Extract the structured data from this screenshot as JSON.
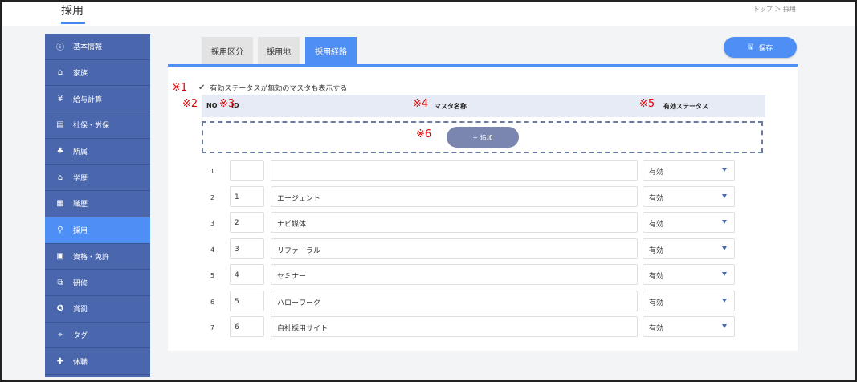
{
  "header": {
    "title": "採用",
    "breadcrumb": "トップ ＞ 採用"
  },
  "sidebar": {
    "items": [
      {
        "label": "基本情報",
        "icon": "info-icon",
        "glyph": "ⓘ",
        "active": false
      },
      {
        "label": "家族",
        "icon": "family-icon",
        "glyph": "⌂",
        "active": false
      },
      {
        "label": "給与計算",
        "icon": "salary-icon",
        "glyph": "¥",
        "active": false
      },
      {
        "label": "社保・労保",
        "icon": "insurance-icon",
        "glyph": "▤",
        "active": false
      },
      {
        "label": "所属",
        "icon": "org-chart-icon",
        "glyph": "♣",
        "active": false
      },
      {
        "label": "学歴",
        "icon": "graduation-cap-icon",
        "glyph": "⌂",
        "active": false
      },
      {
        "label": "職歴",
        "icon": "job-history-icon",
        "glyph": "▦",
        "active": false
      },
      {
        "label": "採用",
        "icon": "recruit-search-icon",
        "glyph": "⚲",
        "active": true
      },
      {
        "label": "資格・免許",
        "icon": "license-icon",
        "glyph": "▣",
        "active": false
      },
      {
        "label": "研修",
        "icon": "training-icon",
        "glyph": "⧉",
        "active": false
      },
      {
        "label": "賞罰",
        "icon": "award-icon",
        "glyph": "✪",
        "active": false
      },
      {
        "label": "タグ",
        "icon": "tag-icon",
        "glyph": "⌖",
        "active": false
      },
      {
        "label": "休職",
        "icon": "plus-cross-icon",
        "glyph": "✚",
        "active": false
      }
    ]
  },
  "tabs": [
    {
      "label": "採用区分",
      "active": false
    },
    {
      "label": "採用地",
      "active": false
    },
    {
      "label": "採用経路",
      "active": true
    }
  ],
  "toolbar": {
    "save_label": "保存",
    "save_icon": "save-icon"
  },
  "annotations": {
    "m1": "※1",
    "m2": "※2",
    "m3": "※3",
    "m4": "※4",
    "m5": "※5",
    "m6": "※6"
  },
  "filter": {
    "show_inactive_label": "有効ステータスが無効のマスタも表示する",
    "checked": true
  },
  "table": {
    "columns": {
      "no": "NO",
      "id": "ID",
      "name": "マスタ名称",
      "status": "有効ステータス"
    },
    "add_label": "+ 追加",
    "rows": [
      {
        "no": "1",
        "id": "",
        "name": "",
        "status": "有効"
      },
      {
        "no": "2",
        "id": "1",
        "name": "エージェント",
        "status": "有効"
      },
      {
        "no": "3",
        "id": "2",
        "name": "ナビ媒体",
        "status": "有効"
      },
      {
        "no": "4",
        "id": "3",
        "name": "リファーラル",
        "status": "有効"
      },
      {
        "no": "5",
        "id": "4",
        "name": "セミナー",
        "status": "有効"
      },
      {
        "no": "6",
        "id": "5",
        "name": "ハローワーク",
        "status": "有効"
      },
      {
        "no": "7",
        "id": "6",
        "name": "自社採用サイト",
        "status": "有効"
      }
    ]
  },
  "colors": {
    "accent": "#4d8ff5",
    "sidebar": "#4a67ad",
    "annotation": "#e00000"
  }
}
